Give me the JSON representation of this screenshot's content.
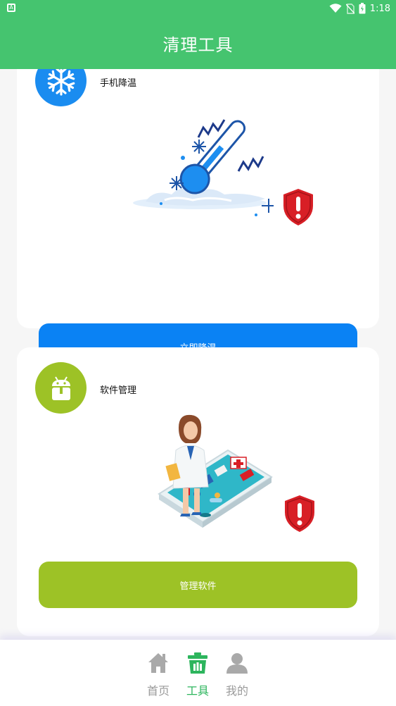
{
  "status_bar": {
    "left_icon": "A",
    "time": "1:18",
    "icons": [
      "wifi-icon",
      "no-sim-icon",
      "battery-icon"
    ]
  },
  "app_bar": {
    "title": "清理工具"
  },
  "cards": [
    {
      "title": "手机降温",
      "icon": "snowflake-icon",
      "illustration": "thermometer-cooling-illustration",
      "button_label": "立即降温",
      "accent_color": "#0a82f4"
    },
    {
      "title": "软件管理",
      "icon": "android-box-icon",
      "illustration": "doctor-phone-illustration",
      "button_label": "管理软件",
      "accent_color": "#9dc226"
    }
  ],
  "tab_bar": {
    "tabs": [
      {
        "label": "首页",
        "icon": "home-icon",
        "active": false
      },
      {
        "label": "工具",
        "icon": "trash-bin-icon",
        "active": true
      },
      {
        "label": "我的",
        "icon": "person-icon",
        "active": false
      }
    ],
    "active_color": "#2db55d",
    "inactive_color": "#9a9a9a"
  },
  "colors": {
    "primary_green": "#45c46f",
    "warning_red": "#d81f26"
  }
}
